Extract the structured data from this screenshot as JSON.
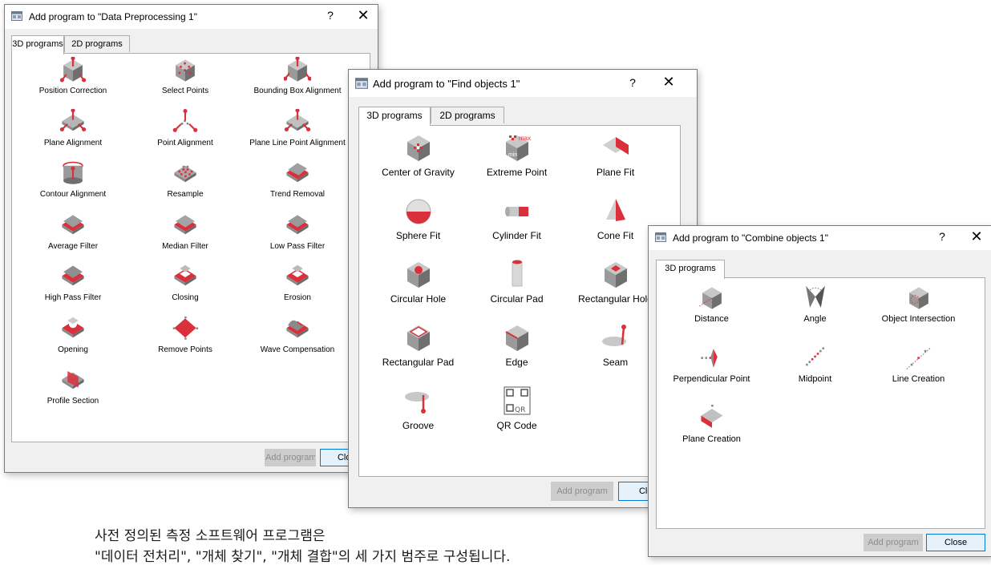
{
  "colors": {
    "accent": "#d9303c",
    "cube": "#8c8c8c",
    "link": "#0078d7"
  },
  "dialog1": {
    "title": "Add program to \"Data Preprocessing 1\"",
    "help": "?",
    "close_x": "✕",
    "tabs": [
      "3D programs",
      "2D programs"
    ],
    "items": [
      {
        "label": "Position Correction",
        "icon": "position-correction-icon"
      },
      {
        "label": "Select Points",
        "icon": "select-points-icon"
      },
      {
        "label": "Bounding Box Alignment",
        "icon": "bounding-box-alignment-icon"
      },
      {
        "label": "Plane Alignment",
        "icon": "plane-alignment-icon"
      },
      {
        "label": "Point Alignment",
        "icon": "point-alignment-icon"
      },
      {
        "label": "Plane Line Point Alignment",
        "icon": "plane-line-point-alignment-icon"
      },
      {
        "label": "Contour Alignment",
        "icon": "contour-alignment-icon"
      },
      {
        "label": "Resample",
        "icon": "resample-icon"
      },
      {
        "label": "Trend Removal",
        "icon": "trend-removal-icon"
      },
      {
        "label": "Average Filter",
        "icon": "average-filter-icon"
      },
      {
        "label": "Median Filter",
        "icon": "median-filter-icon"
      },
      {
        "label": "Low Pass Filter",
        "icon": "low-pass-filter-icon"
      },
      {
        "label": "High Pass Filter",
        "icon": "high-pass-filter-icon"
      },
      {
        "label": "Closing",
        "icon": "closing-icon"
      },
      {
        "label": "Erosion",
        "icon": "erosion-icon"
      },
      {
        "label": "Opening",
        "icon": "opening-icon"
      },
      {
        "label": "Remove Points",
        "icon": "remove-points-icon"
      },
      {
        "label": "Wave Compensation",
        "icon": "wave-compensation-icon"
      },
      {
        "label": "Profile Section",
        "icon": "profile-section-icon"
      }
    ],
    "add_button": "Add program",
    "close_button": "Close"
  },
  "dialog2": {
    "title": "Add program to \"Find objects 1\"",
    "help": "?",
    "close_x": "✕",
    "tabs": [
      "3D programs",
      "2D programs"
    ],
    "items": [
      {
        "label": "Center of Gravity",
        "icon": "center-of-gravity-icon"
      },
      {
        "label": "Extreme Point",
        "icon": "extreme-point-icon"
      },
      {
        "label": "Plane Fit",
        "icon": "plane-fit-icon"
      },
      {
        "label": "Sphere Fit",
        "icon": "sphere-fit-icon"
      },
      {
        "label": "Cylinder Fit",
        "icon": "cylinder-fit-icon"
      },
      {
        "label": "Cone Fit",
        "icon": "cone-fit-icon"
      },
      {
        "label": "Circular Hole",
        "icon": "circular-hole-icon"
      },
      {
        "label": "Circular Pad",
        "icon": "circular-pad-icon"
      },
      {
        "label": "Rectangular Hole",
        "icon": "rectangular-hole-icon"
      },
      {
        "label": "Rectangular Pad",
        "icon": "rectangular-pad-icon"
      },
      {
        "label": "Edge",
        "icon": "edge-icon"
      },
      {
        "label": "Seam",
        "icon": "seam-icon"
      },
      {
        "label": "Groove",
        "icon": "groove-icon"
      },
      {
        "label": "QR Code",
        "icon": "qr-code-icon"
      }
    ],
    "icon_text": {
      "max": "max",
      "min": "min",
      "qr": "QR"
    },
    "add_button": "Add program",
    "close_button": "Close"
  },
  "dialog3": {
    "title": "Add program to \"Combine objects 1\"",
    "help": "?",
    "close_x": "✕",
    "tabs": [
      "3D programs"
    ],
    "items": [
      {
        "label": "Distance",
        "icon": "distance-icon"
      },
      {
        "label": "Angle",
        "icon": "angle-icon"
      },
      {
        "label": "Object Intersection",
        "icon": "object-intersection-icon"
      },
      {
        "label": "Perpendicular Point",
        "icon": "perpendicular-point-icon"
      },
      {
        "label": "Midpoint",
        "icon": "midpoint-icon"
      },
      {
        "label": "Line Creation",
        "icon": "line-creation-icon"
      },
      {
        "label": "Plane Creation",
        "icon": "plane-creation-icon"
      }
    ],
    "add_button": "Add program",
    "close_button": "Close"
  },
  "caption": {
    "line1": "사전 정의된 측정 소프트웨어 프로그램은",
    "line2": "\"데이터 전처리\", \"개체 찾기\", \"개체 결합\"의 세 가지 범주로 구성됩니다."
  }
}
